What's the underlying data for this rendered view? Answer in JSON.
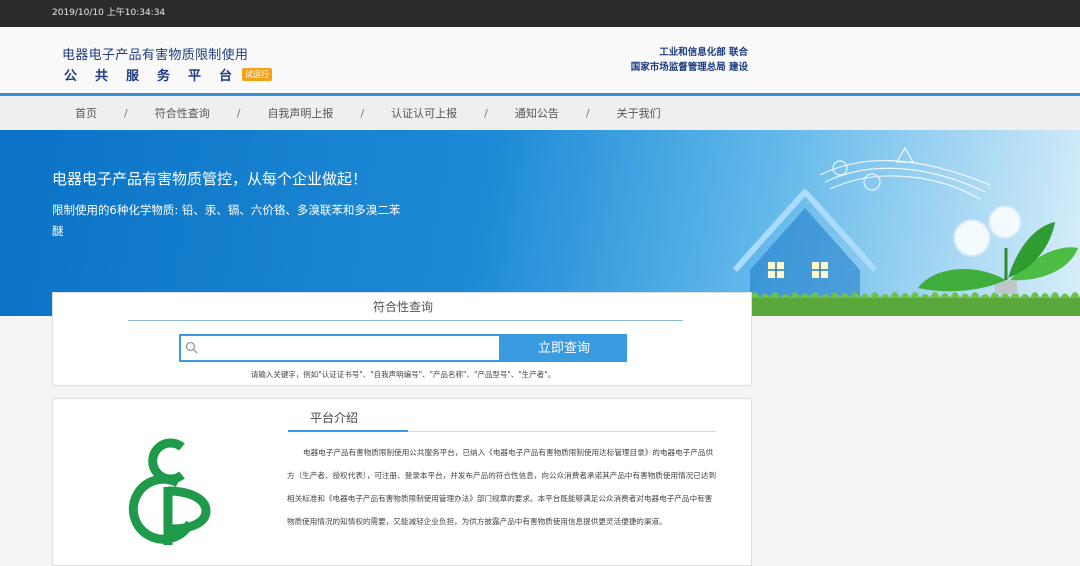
{
  "topbar": {
    "datetime": "2019/10/10 上午10:34:34"
  },
  "header": {
    "title_line1": "电器电子产品有害物质限制使用",
    "title_line2": "公共服务平台",
    "trial_badge": "试运行",
    "org_line1": "工业和信息化部 联合",
    "org_line2": "国家市场监督管理总局 建设"
  },
  "nav": {
    "items": [
      {
        "label": "首页"
      },
      {
        "label": "符合性查询"
      },
      {
        "label": "自我声明上报"
      },
      {
        "label": "认证认可上报"
      },
      {
        "label": "通知公告"
      },
      {
        "label": "关于我们"
      }
    ],
    "separator": "/"
  },
  "banner": {
    "title": "电器电子产品有害物质管控，从每个企业做起！",
    "subtitle": "限制使用的6种化学物质: 铅、汞、镉、六价铬、多溴联苯和多溴二苯醚"
  },
  "search": {
    "title": "符合性查询",
    "input_value": "",
    "button_label": "立即查询",
    "hint": "请输入关键字，例如\"认证证书号\"、\"自我声明编号\"、\"产品名称\"、\"产品型号\"、\"生产者\"。"
  },
  "intro": {
    "title": "平台介绍",
    "logo_letters": "CCGP",
    "body": "电器电子产品有害物质限制使用公共服务平台，已纳入《电器电子产品有害物质限制使用达标管理目录》的电器电子产品供方（生产者、授权代表），可注册、登录本平台，并发布产品的符合性信息，向公众消费者承诺其产品中有害物质使用情况已达到相关标准和《电器电子产品有害物质限制使用管理办法》部门规章的要求。本平台既能够满足公众消费者对电器电子产品中有害物质使用情况的知情权的需要，又能减轻企业负担，为供方披露产品中有害物质使用信息提供更灵活便捷的渠道。"
  },
  "colors": {
    "accent": "#3a9be0",
    "brand": "#1f3d80",
    "trial": "#f2a31a",
    "logo_green": "#1e9a4a"
  }
}
